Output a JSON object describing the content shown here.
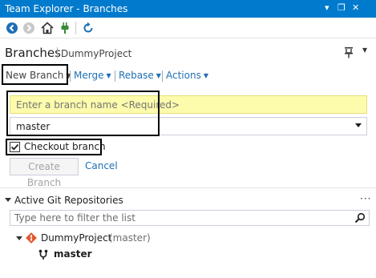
{
  "window": {
    "title": "Team Explorer - Branches",
    "controls": [
      "▾",
      "❐",
      "✕"
    ]
  },
  "toolbar": {
    "icons": [
      "back-icon",
      "forward-icon",
      "home-icon",
      "connect-icon",
      "refresh-icon"
    ]
  },
  "header": {
    "title": "Branches",
    "project": "DummyProject",
    "more": "▾"
  },
  "actions": {
    "new_branch": "New Branch",
    "merge": "Merge",
    "rebase": "Rebase",
    "actions": "Actions"
  },
  "new_branch_form": {
    "name_placeholder": "Enter a branch name <Required>",
    "base_branch": "master",
    "checkout_label": "Checkout branch",
    "checkout_checked": true,
    "create_label": "Create Branch",
    "cancel_label": "Cancel"
  },
  "repositories": {
    "section_title": "Active Git Repositories",
    "menu": "···",
    "filter_placeholder": "Type here to filter the list",
    "items": [
      {
        "name": "DummyProject",
        "branch_note": "(master)",
        "current_branch": "master"
      }
    ]
  },
  "colors": {
    "accent": "#007acc",
    "link": "#1e6fb5",
    "required_input_bg": "#fdfbac",
    "git_icon": "#e4572e"
  }
}
